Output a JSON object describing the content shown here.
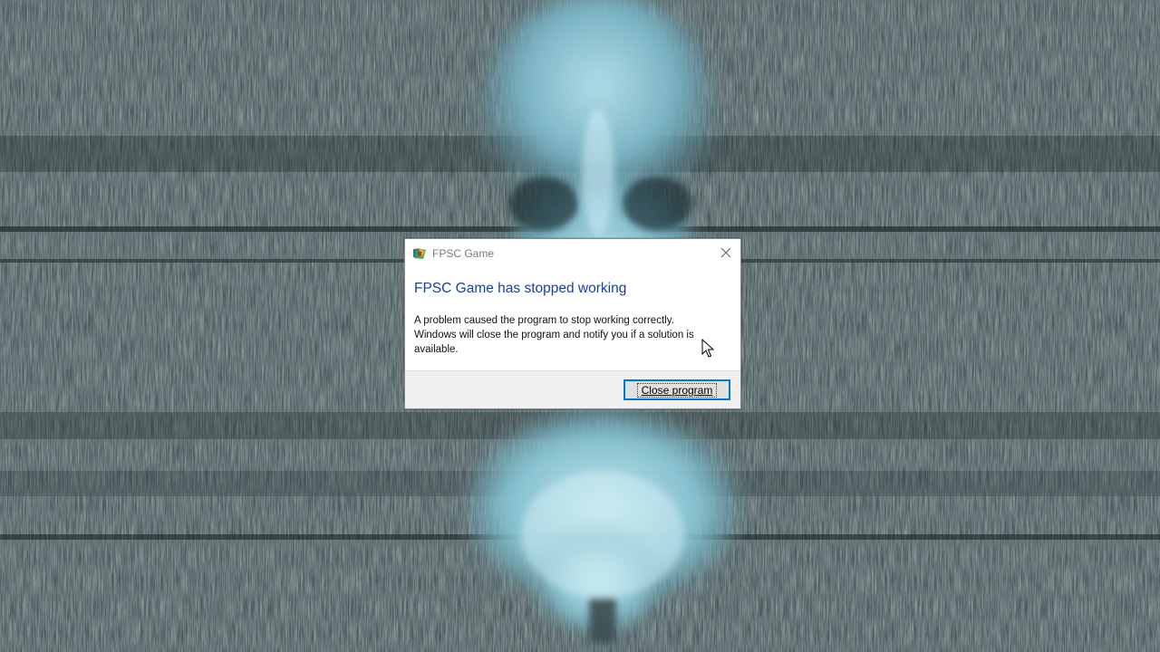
{
  "background": {
    "description_colors": {
      "noise_dark": "#2b3638",
      "noise_light": "#6d7c7d",
      "figure_glow": "#8fd0e0"
    }
  },
  "dialog": {
    "title": "FPSC Game",
    "heading": "FPSC Game has stopped working",
    "message_lines": [
      "A problem caused the program to stop working correctly.",
      "Windows will close the program and notify you if a solution is",
      "available."
    ],
    "close_button_label": "Close program",
    "app_icon": "fpsc-app-icon",
    "close_icon": "close-x-icon",
    "colors": {
      "heading": "#1a3fa3",
      "button_border": "#0078d7",
      "footer": "#f0f0f0"
    }
  },
  "cursor": {
    "icon": "mouse-pointer-icon"
  }
}
